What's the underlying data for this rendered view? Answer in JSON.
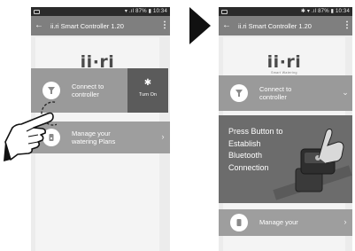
{
  "colors": {
    "statusbar": "#2b2b2b",
    "appbar": "#7f7f7f",
    "row": "#9a9a9a",
    "turn_on_bg": "#5b5b5b",
    "panel_bg": "#6c6c6c",
    "arrow": "#111111"
  },
  "status_bar": {
    "left": {
      "time": "10:34",
      "battery": "87%"
    },
    "right": {
      "time": "10:34",
      "battery": "87%"
    }
  },
  "left_screen": {
    "app_title": "ii.ri Smart Controller 1.20",
    "logo": {
      "text": "ii·ri",
      "subtitle": "Smart Watering"
    },
    "connect_row": {
      "label_line1": "Connect to",
      "label_line2": "controller",
      "icon": "tap-icon"
    },
    "turn_on": {
      "label": "Turn On",
      "icon": "bluetooth-icon"
    },
    "manage_row": {
      "label_line1": "Manage your",
      "label_line2": "watering Plans",
      "icon": "plan-icon",
      "chevron": "›"
    }
  },
  "right_screen": {
    "app_title": "ii.ri Smart Controller 1.20",
    "logo": {
      "text": "ii·ri",
      "subtitle": "Smart Watering"
    },
    "connect_row": {
      "label_line1": "Connect to",
      "label_line2": "controller",
      "icon": "tap-icon",
      "chevron": "⌄"
    },
    "instruction": {
      "lines": [
        "Press Button to",
        "Establish",
        "Bluetooth",
        "Connection"
      ]
    },
    "manage_row": {
      "label_line1": "Manage your",
      "chevron": "›"
    }
  },
  "icons": {
    "back": "←",
    "more": "⋮",
    "bluetooth": "✱"
  }
}
